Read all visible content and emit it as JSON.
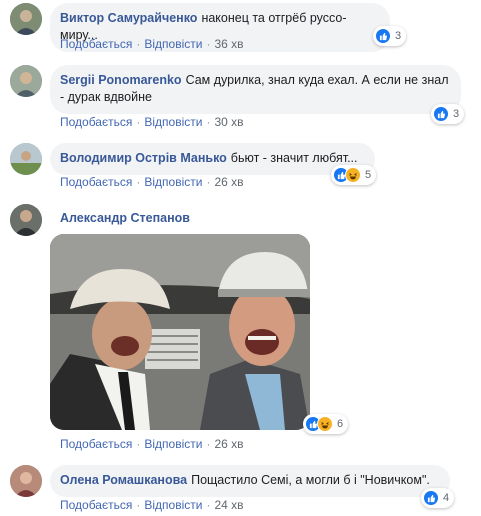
{
  "action_labels": {
    "like": "Подобається",
    "reply": "Відповісти",
    "separator": "·"
  },
  "comments": [
    {
      "author": "Виктор Самурайченко",
      "text": "наконец та отгрёб руссо-миру...",
      "time": "36 хв",
      "reactions": [
        "like-icon"
      ],
      "reaction_count": "3"
    },
    {
      "author": "Sergii Ponomarenko",
      "text": "Сам дурилка, знал куда ехал. А если не знал - дурак вдвойне",
      "time": "30 хв",
      "reactions": [
        "like-icon"
      ],
      "reaction_count": "3"
    },
    {
      "author": "Володимир Острів Манько",
      "text": "бьют - значит любят...",
      "time": "26 хв",
      "reactions": [
        "like-icon",
        "haha-icon"
      ],
      "reaction_count": "5"
    },
    {
      "author": "Александр Степанов",
      "text": "",
      "time": "26 хв",
      "reactions": [
        "like-icon",
        "haha-icon"
      ],
      "reaction_count": "6"
    },
    {
      "author": "Олена Ромашканова",
      "text": "Пощастило Семі, а могли б і \"Новичком\".",
      "time": "24 хв",
      "reactions": [
        "like-icon"
      ],
      "reaction_count": "4"
    }
  ],
  "colors": {
    "name": "#385898",
    "action": "#4267b2",
    "bubble": "#f2f3f5",
    "like": "#1877f2",
    "haha": "#f7b125"
  }
}
